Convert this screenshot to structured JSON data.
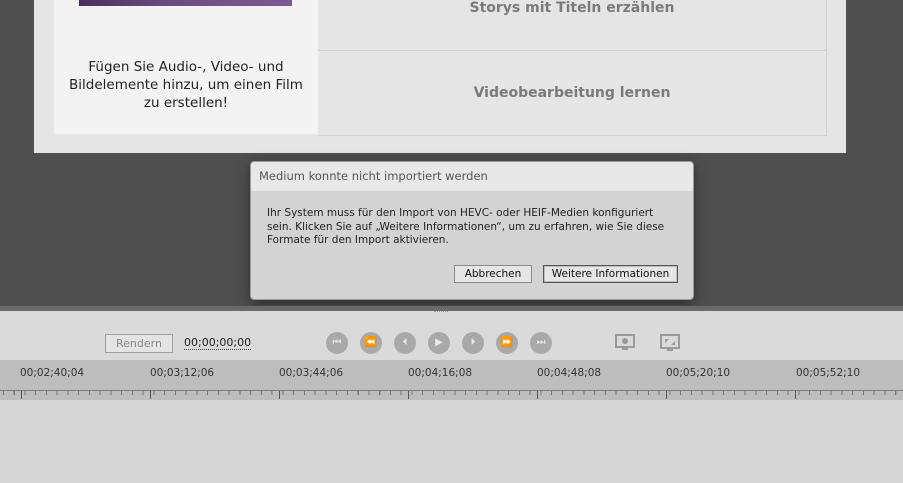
{
  "welcome": {
    "card_text": "Fügen Sie Audio-, Video- und Bildelemente hinzu, um einen Film zu erstellen!",
    "topics": [
      "Storys mit Titeln erzählen",
      "Videobearbeitung lernen"
    ]
  },
  "dialog": {
    "title": "Medium konnte nicht importiert werden",
    "message": "Ihr System muss für den Import von HEVC- oder HEIF-Medien konfiguriert sein. Klicken Sie auf „Weitere Informationen“, um zu erfahren, wie Sie diese Formate für den Import aktivieren.",
    "cancel_label": "Abbrechen",
    "more_label": "Weitere Informationen"
  },
  "transport": {
    "render_label": "Rendern",
    "timecode": "00;00;00;00",
    "controls": [
      {
        "name": "go-to-start-icon",
        "glyph": "⏮"
      },
      {
        "name": "rewind-icon",
        "glyph": "⏪"
      },
      {
        "name": "step-back-icon",
        "glyph": "⏴"
      },
      {
        "name": "play-icon",
        "glyph": "▶"
      },
      {
        "name": "step-forward-icon",
        "glyph": "⏵"
      },
      {
        "name": "fast-forward-icon",
        "glyph": "⏩"
      },
      {
        "name": "go-to-end-icon",
        "glyph": "⏭"
      }
    ],
    "display_icons": [
      "monitor-settings-icon",
      "fullscreen-icon"
    ]
  },
  "timeline": {
    "ruler_labels": [
      "00;02;40;04",
      "00;03;12;06",
      "00;03;44;06",
      "00;04;16;08",
      "00;04;48;08",
      "00;05;20;10",
      "00;05;52;10"
    ]
  }
}
